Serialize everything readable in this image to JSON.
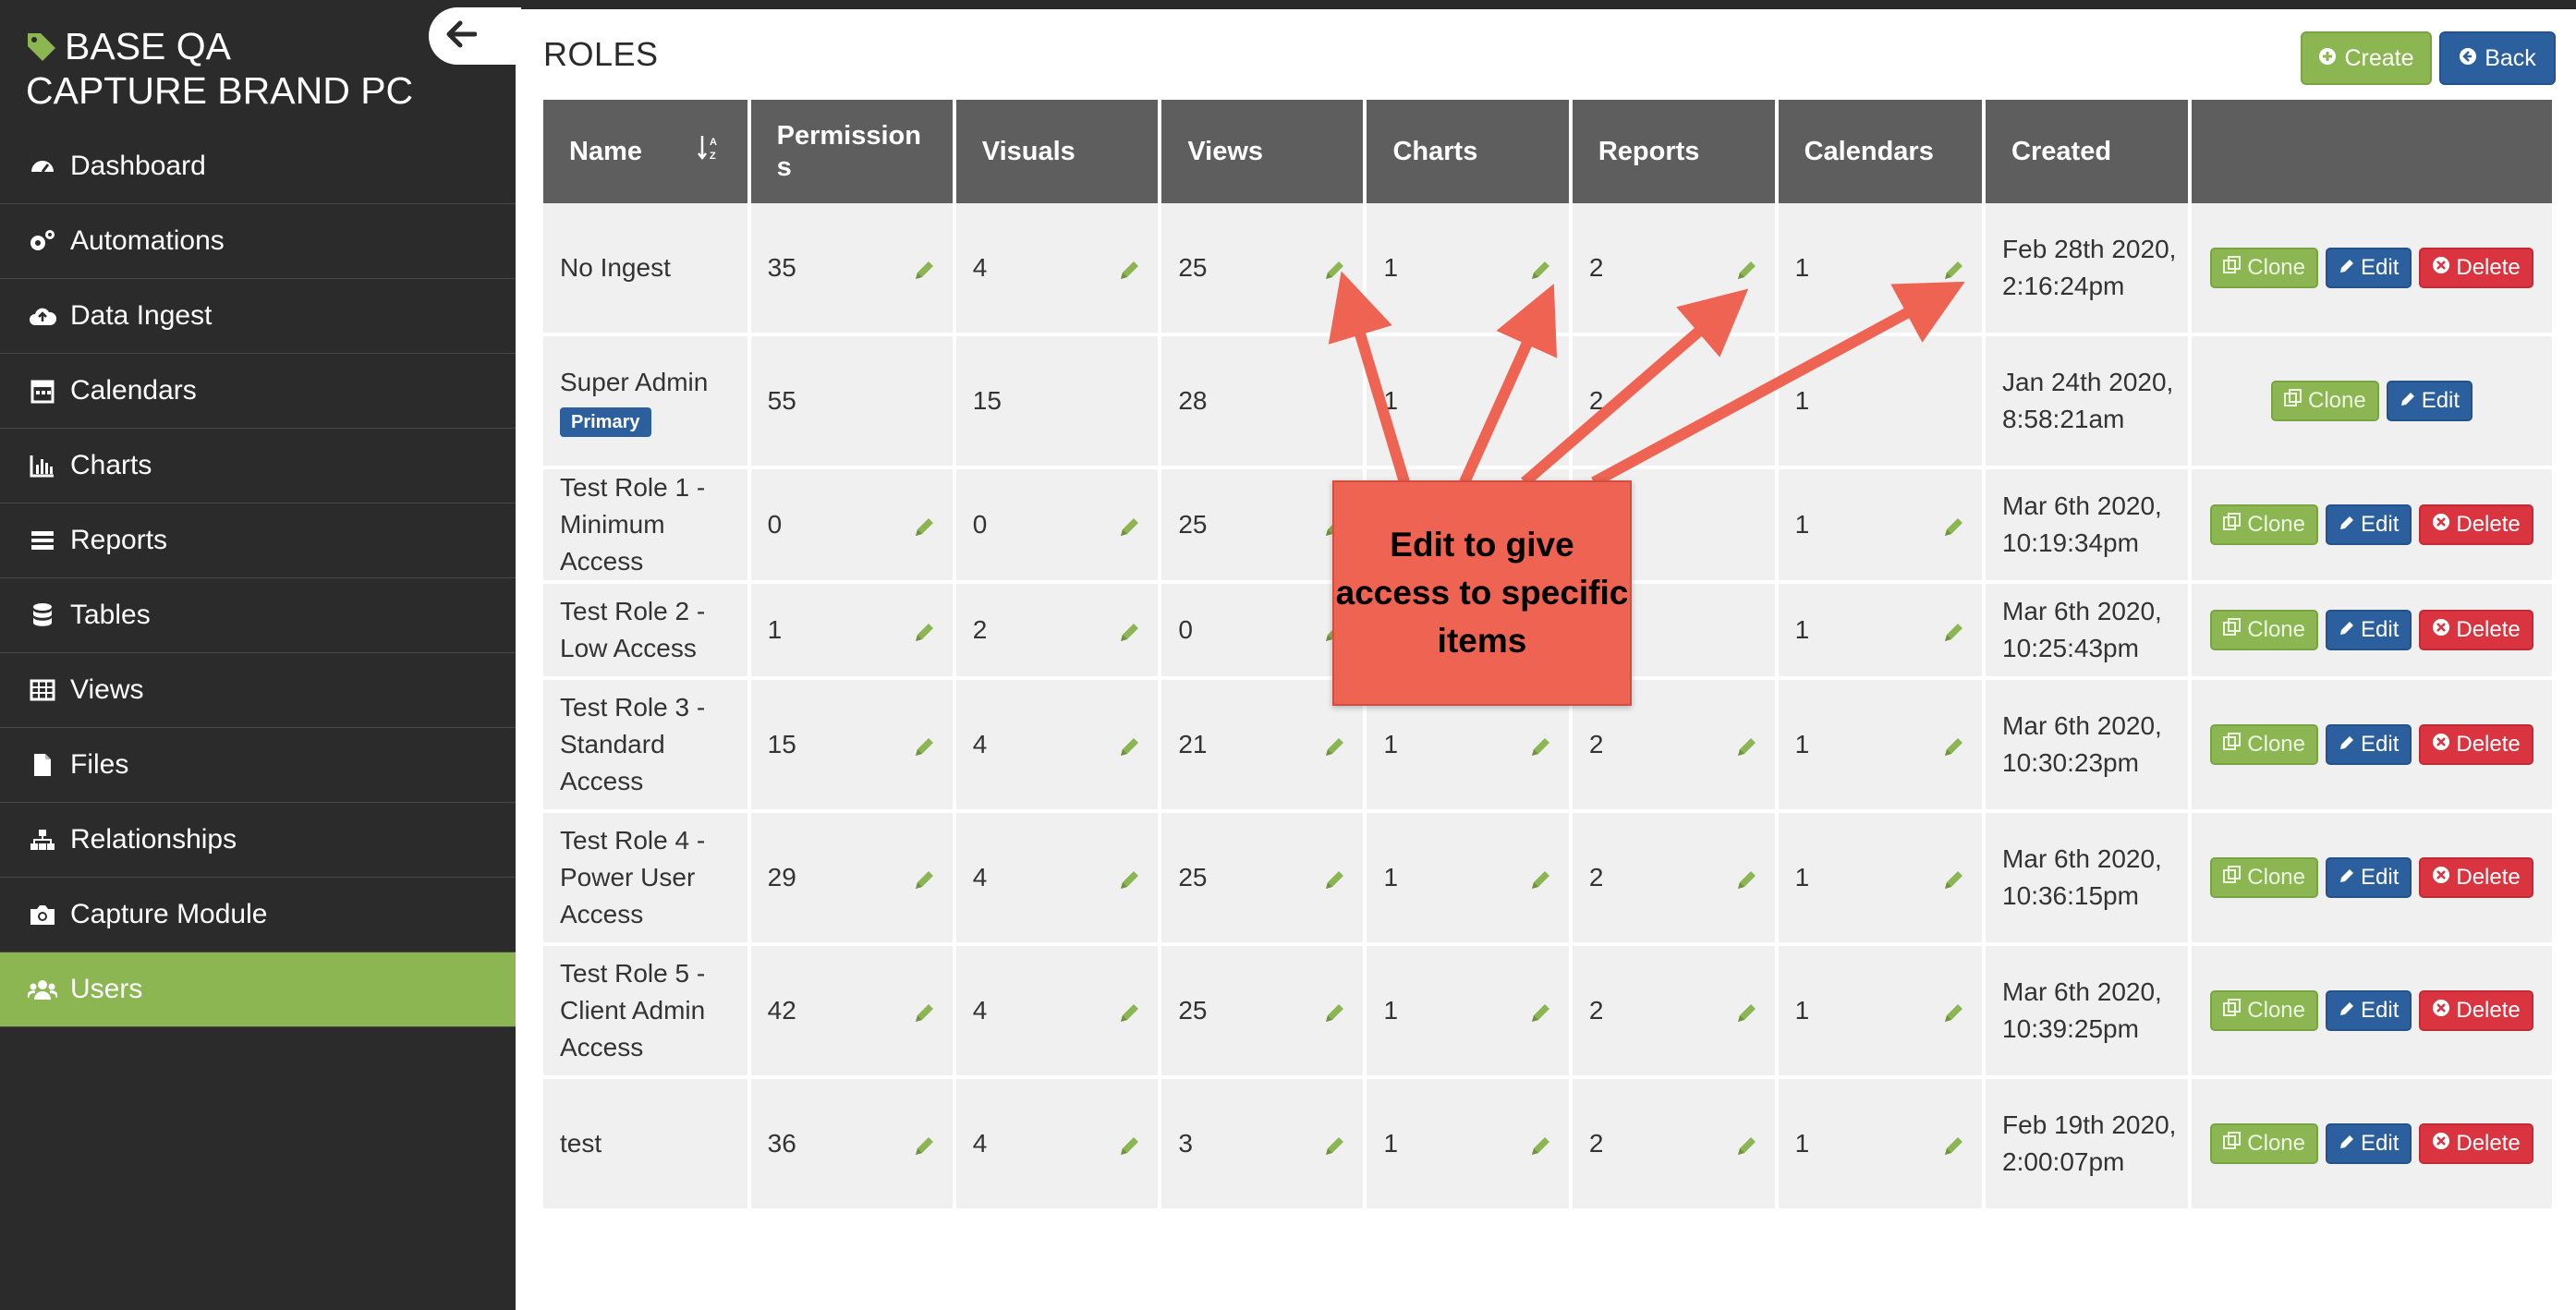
{
  "brand": {
    "line1": "BASE QA",
    "line2": "CAPTURE BRAND PC"
  },
  "sidebar": {
    "items": [
      {
        "label": "Dashboard",
        "icon": "dashboard-icon"
      },
      {
        "label": "Automations",
        "icon": "gears-icon"
      },
      {
        "label": "Data Ingest",
        "icon": "cloud-upload-icon"
      },
      {
        "label": "Calendars",
        "icon": "calendar-icon"
      },
      {
        "label": "Charts",
        "icon": "bar-chart-icon"
      },
      {
        "label": "Reports",
        "icon": "list-icon"
      },
      {
        "label": "Tables",
        "icon": "database-icon"
      },
      {
        "label": "Views",
        "icon": "table-icon"
      },
      {
        "label": "Files",
        "icon": "file-icon"
      },
      {
        "label": "Relationships",
        "icon": "sitemap-icon"
      },
      {
        "label": "Capture Module",
        "icon": "camera-icon"
      },
      {
        "label": "Users",
        "icon": "users-icon",
        "active": true
      }
    ]
  },
  "page": {
    "title": "ROLES"
  },
  "toolbar": {
    "create_label": "Create",
    "back_label": "Back"
  },
  "table": {
    "headers": [
      "Name",
      "Permissions",
      "Visuals",
      "Views",
      "Charts",
      "Reports",
      "Calendars",
      "Created",
      ""
    ],
    "rows": [
      {
        "name": "No Ingest",
        "badge": "",
        "perm": "35",
        "vis": "4",
        "views": "25",
        "charts": "1",
        "reports": "2",
        "cal": "1",
        "created": "Feb 28th 2020, 2:16:24pm",
        "clone": "Clone",
        "edit": "Edit",
        "delete": "Delete"
      },
      {
        "name": "Super Admin",
        "badge": "Primary",
        "perm": "55",
        "vis": "15",
        "views": "28",
        "charts": "1",
        "reports": "2",
        "cal": "1",
        "created": "Jan 24th 2020, 8:58:21am",
        "clone": "Clone",
        "edit": "Edit",
        "delete": ""
      },
      {
        "name": "Test Role 1 - Minimum Access",
        "badge": "",
        "perm": "0",
        "vis": "0",
        "views": "25",
        "charts": "",
        "reports": "",
        "cal": "1",
        "created": "Mar 6th 2020, 10:19:34pm",
        "clone": "Clone",
        "edit": "Edit",
        "delete": "Delete"
      },
      {
        "name": "Test Role 2 - Low Access",
        "badge": "",
        "perm": "1",
        "vis": "2",
        "views": "0",
        "charts": "",
        "reports": "",
        "cal": "1",
        "created": "Mar 6th 2020, 10:25:43pm",
        "clone": "Clone",
        "edit": "Edit",
        "delete": "Delete"
      },
      {
        "name": "Test Role 3 - Standard Access",
        "badge": "",
        "perm": "15",
        "vis": "4",
        "views": "21",
        "charts": "1",
        "reports": "2",
        "cal": "1",
        "created": "Mar 6th 2020, 10:30:23pm",
        "clone": "Clone",
        "edit": "Edit",
        "delete": "Delete"
      },
      {
        "name": "Test Role 4 - Power User Access",
        "badge": "",
        "perm": "29",
        "vis": "4",
        "views": "25",
        "charts": "1",
        "reports": "2",
        "cal": "1",
        "created": "Mar 6th 2020, 10:36:15pm",
        "clone": "Clone",
        "edit": "Edit",
        "delete": "Delete"
      },
      {
        "name": "Test Role 5 - Client Admin Access",
        "badge": "",
        "perm": "42",
        "vis": "4",
        "views": "25",
        "charts": "1",
        "reports": "2",
        "cal": "1",
        "created": "Mar 6th 2020, 10:39:25pm",
        "clone": "Clone",
        "edit": "Edit",
        "delete": "Delete"
      },
      {
        "name": "test",
        "badge": "",
        "perm": "36",
        "vis": "4",
        "views": "3",
        "charts": "1",
        "reports": "2",
        "cal": "1",
        "created": "Feb 19th 2020, 2:00:07pm",
        "clone": "Clone",
        "edit": "Edit",
        "delete": "Delete"
      }
    ]
  },
  "callout": {
    "text": "Edit to give access to specific items"
  },
  "colors": {
    "accent_green": "#8bb652",
    "primary_blue": "#2c5f9e",
    "danger_red": "#d9343f",
    "callout": "#ee6352",
    "sidebar_bg": "#2b2b2b",
    "header_bg": "#5e5e5e"
  }
}
